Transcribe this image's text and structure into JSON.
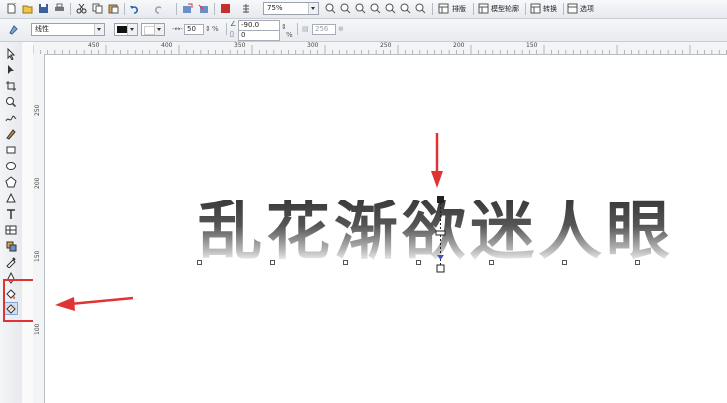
{
  "toolbar": {
    "zoom": "75%",
    "btn_layout": "排版",
    "btn_outline": "模型轮廓",
    "btn_convert": "转换",
    "btn_options": "选项"
  },
  "property_bar": {
    "fill_type": "线性",
    "angle": "-90.0",
    "edge_pad": "0",
    "edge_pad_unit": "%",
    "midpoint": "50",
    "midpoint_unit": "%",
    "steps": "256"
  },
  "ruler_top_labels": [
    "450",
    "400",
    "350",
    "300",
    "250",
    "200",
    "150"
  ],
  "ruler_left_labels": [
    "250",
    "200",
    "150",
    "100"
  ],
  "canvas": {
    "text": "乱花渐欲迷人眼"
  },
  "colors": {
    "highlight": "#e03434",
    "arrow": "#e03434",
    "gradient_top": "#3a3a3a",
    "gradient_bottom": "#ffffff"
  }
}
